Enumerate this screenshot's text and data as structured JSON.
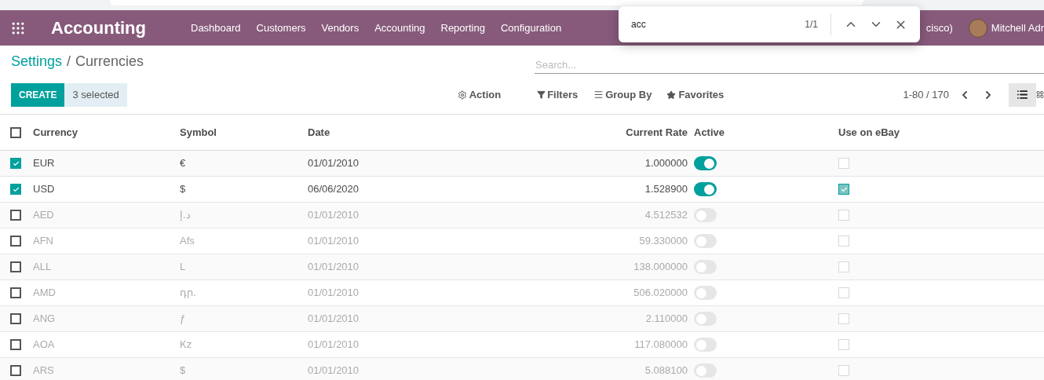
{
  "navbar": {
    "app_title": "Accounting",
    "menu": [
      "Dashboard",
      "Customers",
      "Vendors",
      "Accounting",
      "Reporting",
      "Configuration"
    ],
    "company_fragment": "cisco)",
    "user_name": "Mitchell Adr"
  },
  "find_bar": {
    "query": "acc",
    "match_count": "1/1"
  },
  "breadcrumb": {
    "parent": "Settings",
    "separator": "/",
    "current": "Currencies"
  },
  "search": {
    "placeholder": "Search..."
  },
  "toolbar": {
    "create": "CREATE",
    "selected_count": "3 selected",
    "action": "Action",
    "filters": "Filters",
    "group_by": "Group By",
    "favorites": "Favorites",
    "pager": "1-80 / 170"
  },
  "table": {
    "header_checked": false,
    "columns": [
      "Currency",
      "Symbol",
      "Date",
      "Current Rate",
      "Active",
      "Use on eBay"
    ],
    "rows": [
      {
        "selected": true,
        "currency": "EUR",
        "symbol": "€",
        "date": "01/01/2010",
        "rate": "1.000000",
        "active": true,
        "ebay": false
      },
      {
        "selected": true,
        "currency": "USD",
        "symbol": "$",
        "date": "06/06/2020",
        "rate": "1.528900",
        "active": true,
        "ebay": true
      },
      {
        "selected": false,
        "currency": "AED",
        "symbol": "د.إ",
        "date": "01/01/2010",
        "rate": "4.512532",
        "active": false,
        "ebay": false
      },
      {
        "selected": false,
        "currency": "AFN",
        "symbol": "Afs",
        "date": "01/01/2010",
        "rate": "59.330000",
        "active": false,
        "ebay": false
      },
      {
        "selected": false,
        "currency": "ALL",
        "symbol": "L",
        "date": "01/01/2010",
        "rate": "138.000000",
        "active": false,
        "ebay": false
      },
      {
        "selected": false,
        "currency": "AMD",
        "symbol": "դր.",
        "date": "01/01/2010",
        "rate": "506.020000",
        "active": false,
        "ebay": false
      },
      {
        "selected": false,
        "currency": "ANG",
        "symbol": "ƒ",
        "date": "01/01/2010",
        "rate": "2.110000",
        "active": false,
        "ebay": false
      },
      {
        "selected": false,
        "currency": "AOA",
        "symbol": "Kz",
        "date": "01/01/2010",
        "rate": "117.080000",
        "active": false,
        "ebay": false
      },
      {
        "selected": false,
        "currency": "ARS",
        "symbol": "$",
        "date": "01/01/2010",
        "rate": "5.088100",
        "active": false,
        "ebay": false
      }
    ]
  }
}
